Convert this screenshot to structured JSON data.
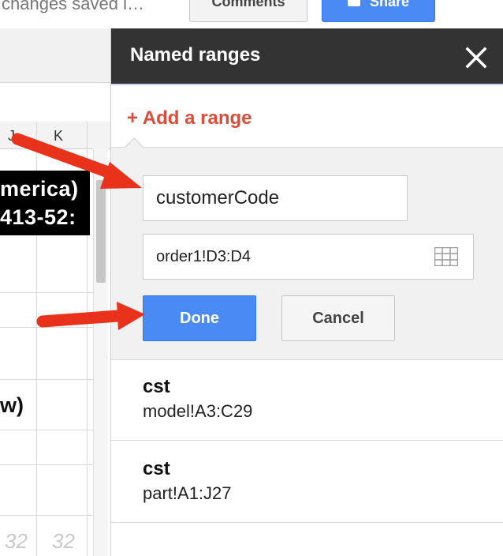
{
  "topbar": {
    "save_status": "changes saved i…",
    "comments_label": "Comments",
    "share_label": "Share"
  },
  "sheet": {
    "columns": [
      "J",
      "K"
    ],
    "cells": {
      "line1": "merica)",
      "line2": "413-52:",
      "bold": "w)",
      "num1": "32",
      "num2": "32"
    }
  },
  "panel": {
    "title": "Named ranges",
    "add_range": "+ Add a range",
    "name_value": "customerCode",
    "range_value": "order1!D3:D4",
    "done_label": "Done",
    "cancel_label": "Cancel",
    "ranges": [
      {
        "name": "cst",
        "ref": "model!A3:C29"
      },
      {
        "name": "cst",
        "ref": "part!A1:J27"
      }
    ]
  },
  "colors": {
    "accent_blue": "#4a8af4",
    "link_red": "#dd4b39",
    "header_dark": "#333333",
    "arrow_red": "#e8321c"
  }
}
